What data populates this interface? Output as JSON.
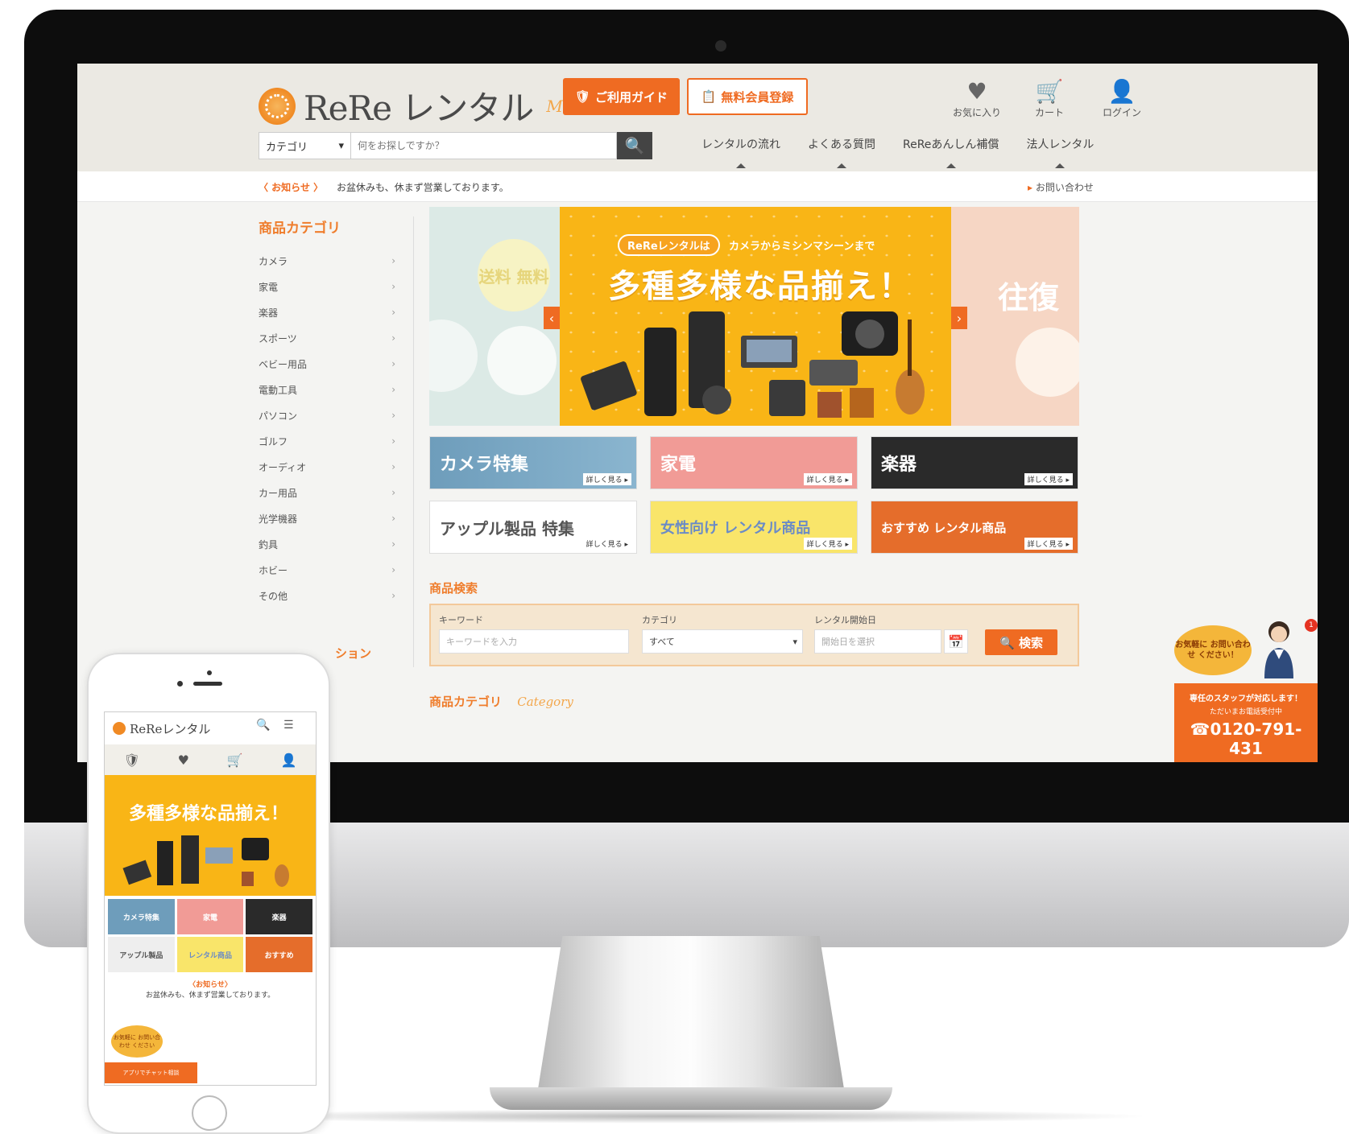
{
  "header": {
    "logo_text": "ReRe レンタル",
    "logo_sub": "Mobile",
    "guide_label": "ご利用ガイド",
    "register_label": "無料会員登録",
    "icons": [
      {
        "icon": "heart-icon",
        "glyph": "♥",
        "label": "お気に入り"
      },
      {
        "icon": "cart-icon",
        "glyph": "🛒",
        "label": "カート"
      },
      {
        "icon": "user-icon",
        "glyph": "👤",
        "label": "ログイン"
      }
    ]
  },
  "search": {
    "category_label": "カテゴリ",
    "placeholder": "何をお探しですか？",
    "button_glyph": "🔍"
  },
  "gnav": [
    "レンタルの流れ",
    "よくある質問",
    "ReReあんしん補償",
    "法人レンタル"
  ],
  "notice": {
    "label": "〈 お知らせ 〉",
    "text": "お盆休みも、休まず営業しております。",
    "contact": "お問い合わせ"
  },
  "sidebar": {
    "heading": "商品カテゴリ",
    "items": [
      "カメラ",
      "家電",
      "楽器",
      "スポーツ",
      "ベビー用品",
      "電動工具",
      "パソコン",
      "ゴルフ",
      "オーディオ",
      "カー用品",
      "光学機器",
      "釣具",
      "ホビー",
      "その他"
    ],
    "chevron": "›",
    "heading2": "ション"
  },
  "hero": {
    "left_circle": "送料 無料",
    "pill": "ReReレンタルは",
    "pill_after": "カメラからミシンマシーンまで",
    "title": "多種多様な品揃え！",
    "right_text": "往復",
    "prev": "‹",
    "next": "›"
  },
  "tiles": [
    {
      "label": "カメラ特集",
      "more": "詳しく見る ▸",
      "cls": "t-cam"
    },
    {
      "label": "家電",
      "more": "詳しく見る ▸",
      "cls": "t-kaden"
    },
    {
      "label": "楽器",
      "more": "詳しく見る ▸",
      "cls": "t-gakki"
    },
    {
      "label": "アップル製品 特集",
      "more": "詳しく見る ▸",
      "cls": "t-apple"
    },
    {
      "label": "女性向け レンタル商品",
      "more": "詳しく見る ▸",
      "cls": "t-josei"
    },
    {
      "label": "おすすめ レンタル商品",
      "more": "詳しく見る ▸",
      "cls": "t-osusume"
    }
  ],
  "product_search": {
    "heading": "商品検索",
    "keyword_label": "キーワード",
    "keyword_placeholder": "キーワードを入力",
    "category_label": "カテゴリ",
    "category_value": "すべて",
    "date_label": "レンタル開始日",
    "date_placeholder": "開始日を選択",
    "calendar_glyph": "📅",
    "button": "🔍 検索"
  },
  "category_section": {
    "heading": "商品カテゴリ",
    "script": "Category"
  },
  "support": {
    "bubble": "お気軽に お問い合わせ ください！",
    "badge": "1",
    "line1": "専任のスタッフが対応します！",
    "line2": "ただいまお電話受付中",
    "phone": "0120-791-431"
  },
  "phone": {
    "logo_text": "ReReレンタル",
    "nav": [
      "🛡",
      "♥",
      "🛒",
      "👤"
    ],
    "hero_title": "多種多様な品揃え！",
    "tiles": [
      "カメラ特集",
      "家電",
      "楽器",
      "アップル製品",
      "レンタル商品",
      "おすすめ"
    ],
    "news_head": "〈お知らせ〉",
    "news_text": "お盆休みも、休まず営業しております。",
    "support_bubble": "お気軽に お問い合わせ ください",
    "support_bar": "アプリでチャット相談"
  },
  "colors": {
    "accent": "#ef6b22",
    "header_bg": "#ebe9e3",
    "hero_yellow": "#f9b516"
  }
}
